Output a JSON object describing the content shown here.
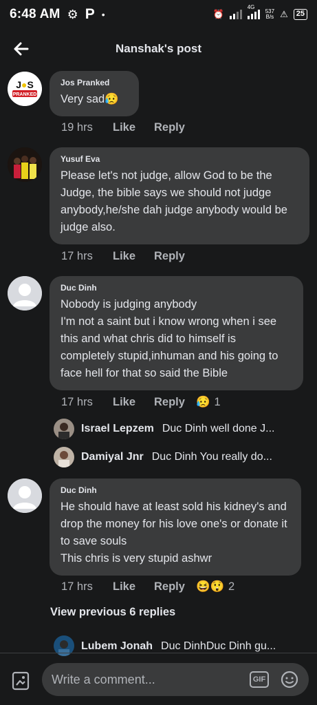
{
  "status_bar": {
    "time": "6:48 AM",
    "app_letter": "P",
    "dot": "•",
    "network": "4G",
    "net_speed_top": "537",
    "net_speed_bottom": "B/s",
    "battery": "25"
  },
  "header": {
    "title": "Nanshak's post",
    "back_icon": "arrow-left-icon"
  },
  "comments": [
    {
      "author": "Jos Pranked",
      "avatar_text": "J●S",
      "avatar_sub": "PRANKED",
      "text": "Very sad",
      "emoji": "😥",
      "time": "19 hrs",
      "like": "Like",
      "reply": "Reply"
    },
    {
      "author": "Yusuf Eva",
      "text": "Please let's not judge, allow God to be the Judge,  the bible says we should not judge anybody,he/she dah judge anybody would be judge also.",
      "time": "17 hrs",
      "like": "Like",
      "reply": "Reply"
    },
    {
      "author": "Duc Dinh",
      "text_lines": [
        "Nobody is judging anybody",
        "I'm not a saint but i know wrong when i see this and what chris did to himself is completely stupid,inhuman and his going to face hell for that so said the Bible"
      ],
      "time": "17 hrs",
      "like": "Like",
      "reply": "Reply",
      "reaction_emoji": "😥",
      "reaction_count": "1"
    },
    {
      "author": "Duc Dinh",
      "text_lines": [
        "He should have at least sold his kidney's and drop the money for his love one's or donate it to save souls",
        "This chris is very stupid ashwr"
      ],
      "time": "17 hrs",
      "like": "Like",
      "reply": "Reply",
      "reaction_emoji": "😆😲",
      "reaction_count": "2"
    }
  ],
  "replies": [
    {
      "name": "Israel Lepzem",
      "snippet": "Duc Dinh well done J..."
    },
    {
      "name": "Damiyal Jnr",
      "snippet": "Duc Dinh You really do..."
    },
    {
      "name": "Lubem Jonah",
      "snippet": "Duc DinhDuc Dinh gu..."
    }
  ],
  "view_previous": "View previous 6 replies",
  "composer": {
    "placeholder": "Write a comment...",
    "gif_label": "GIF"
  },
  "colors": {
    "background": "#18191a",
    "bubble": "#3a3b3c",
    "secondary_text": "#b0b3b8"
  }
}
